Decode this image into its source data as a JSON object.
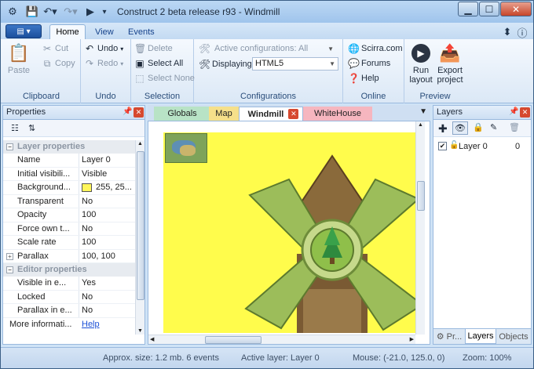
{
  "window": {
    "title": "Construct 2 beta release r93 - Windmill"
  },
  "ribbon_tabs": [
    "Home",
    "View",
    "Events"
  ],
  "ribbon": {
    "clipboard": {
      "label": "Clipboard",
      "paste": "Paste",
      "cut": "Cut",
      "copy": "Copy"
    },
    "undo": {
      "label": "Undo",
      "undo": "Undo",
      "redo": "Redo"
    },
    "selection": {
      "label": "Selection",
      "delete": "Delete",
      "select_all": "Select All",
      "select_none": "Select None"
    },
    "configurations": {
      "label": "Configurations",
      "active_config": "Active configurations: All",
      "displaying_label": "Displaying:",
      "displaying_value": "HTML5"
    },
    "online": {
      "label": "Online",
      "scirra": "Scirra.com",
      "forums": "Forums",
      "help": "Help"
    },
    "preview": {
      "label": "Preview",
      "run": "Run layout",
      "export": "Export project"
    }
  },
  "properties": {
    "title": "Properties",
    "cat_layer": "Layer properties",
    "cat_editor": "Editor properties",
    "rows": [
      {
        "key": "Name",
        "value": "Layer 0"
      },
      {
        "key": "Initial visibili...",
        "value": "Visible"
      },
      {
        "key": "Background...",
        "value": "255, 25..."
      },
      {
        "key": "Transparent",
        "value": "No"
      },
      {
        "key": "Opacity",
        "value": "100"
      },
      {
        "key": "Force own t...",
        "value": "No"
      },
      {
        "key": "Scale rate",
        "value": "100"
      },
      {
        "key": "Parallax",
        "value": "100, 100"
      }
    ],
    "editor_rows": [
      {
        "key": "Visible in e...",
        "value": "Yes"
      },
      {
        "key": "Locked",
        "value": "No"
      },
      {
        "key": "Parallax in e...",
        "value": "No"
      }
    ],
    "more_info": "More informati...",
    "help_link": "Help",
    "bg_color": "#fff65a"
  },
  "document_tabs": [
    {
      "label": "Globals",
      "color": "#b8e3c6"
    },
    {
      "label": "Map",
      "color": "#f6e08a"
    },
    {
      "label": "Windmill",
      "color": "#ffffff"
    },
    {
      "label": "WhiteHouse",
      "color": "#f6b6bf"
    }
  ],
  "layout": {
    "background": "#fffc4c"
  },
  "layers": {
    "title": "Layers",
    "items": [
      {
        "name": "Layer 0",
        "index": "0",
        "visible": true,
        "locked": false
      }
    ],
    "bottom_tabs": [
      "Pr...",
      "Layers",
      "Objects"
    ]
  },
  "status": {
    "size": "Approx. size: 1.2 mb. 6 events",
    "active_layer": "Active layer: Layer 0",
    "mouse": "Mouse: (-21.0, 125.0, 0)",
    "zoom": "Zoom: 100%"
  }
}
